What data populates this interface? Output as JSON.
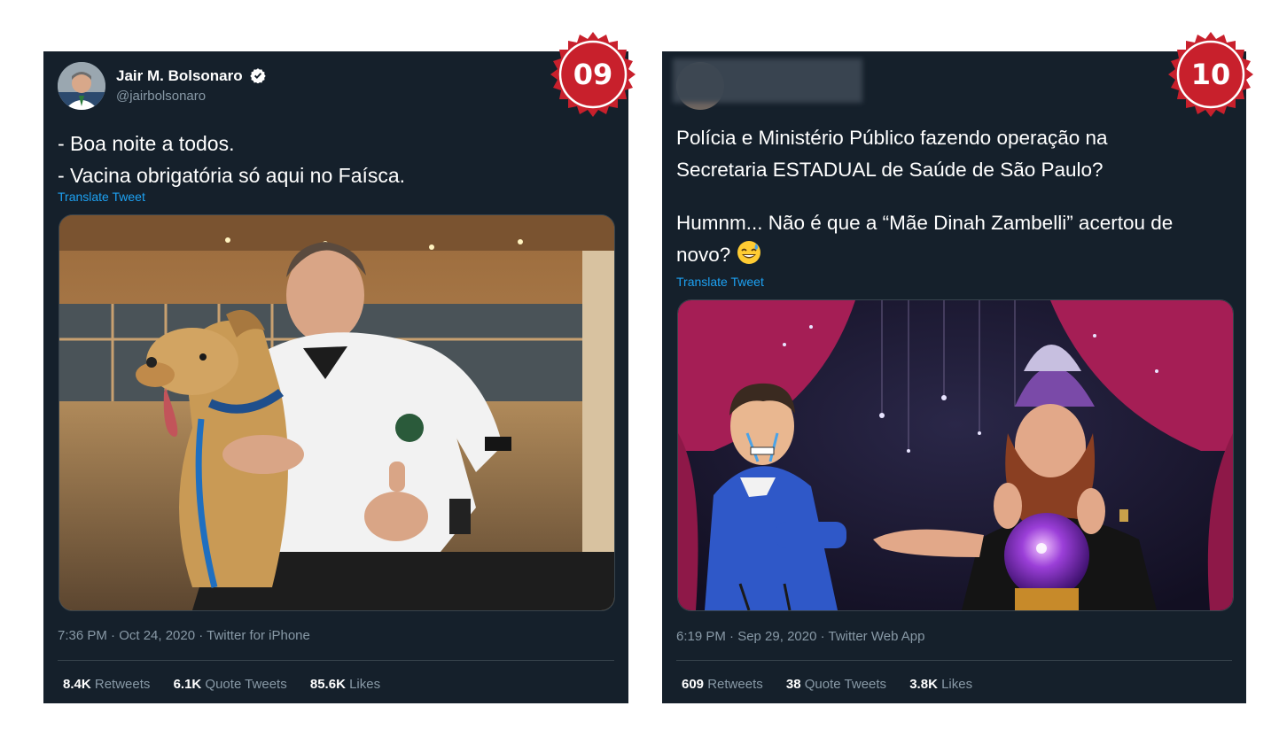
{
  "tweets": [
    {
      "badge": "09",
      "author_name": "Jair M. Bolsonaro",
      "author_handle": "@jairbolsonaro",
      "text_lines": [
        "- Boa noite a todos.",
        "- Vacina obrigatória só aqui no Faísca."
      ],
      "translate_label": "Translate Tweet",
      "meta": "7:36 PM · Oct 24, 2020 · Twitter for iPhone",
      "stats": {
        "retweets_count": "8.4K",
        "retweets_label": "Retweets",
        "quotes_count": "6.1K",
        "quotes_label": "Quote Tweets",
        "likes_count": "85.6K",
        "likes_label": "Likes"
      }
    },
    {
      "badge": "10",
      "text_lines": [
        "Polícia e Ministério Público fazendo operação na",
        "Secretaria ESTADUAL de Saúde de São Paulo?",
        "",
        "Humnm... Não é que a “Mãe Dinah Zambelli” acertou de",
        "novo?"
      ],
      "translate_label": "Translate Tweet",
      "meta": "6:19 PM · Sep 29, 2020 · Twitter Web App",
      "stats": {
        "retweets_count": "609",
        "retweets_label": "Retweets",
        "quotes_count": "38",
        "quotes_label": "Quote Tweets",
        "likes_count": "3.8K",
        "likes_label": "Likes"
      }
    }
  ],
  "colors": {
    "card_bg": "#15202b",
    "link_blue": "#1da1f2",
    "muted_text": "#8899a6",
    "badge_red": "#c8202c"
  }
}
